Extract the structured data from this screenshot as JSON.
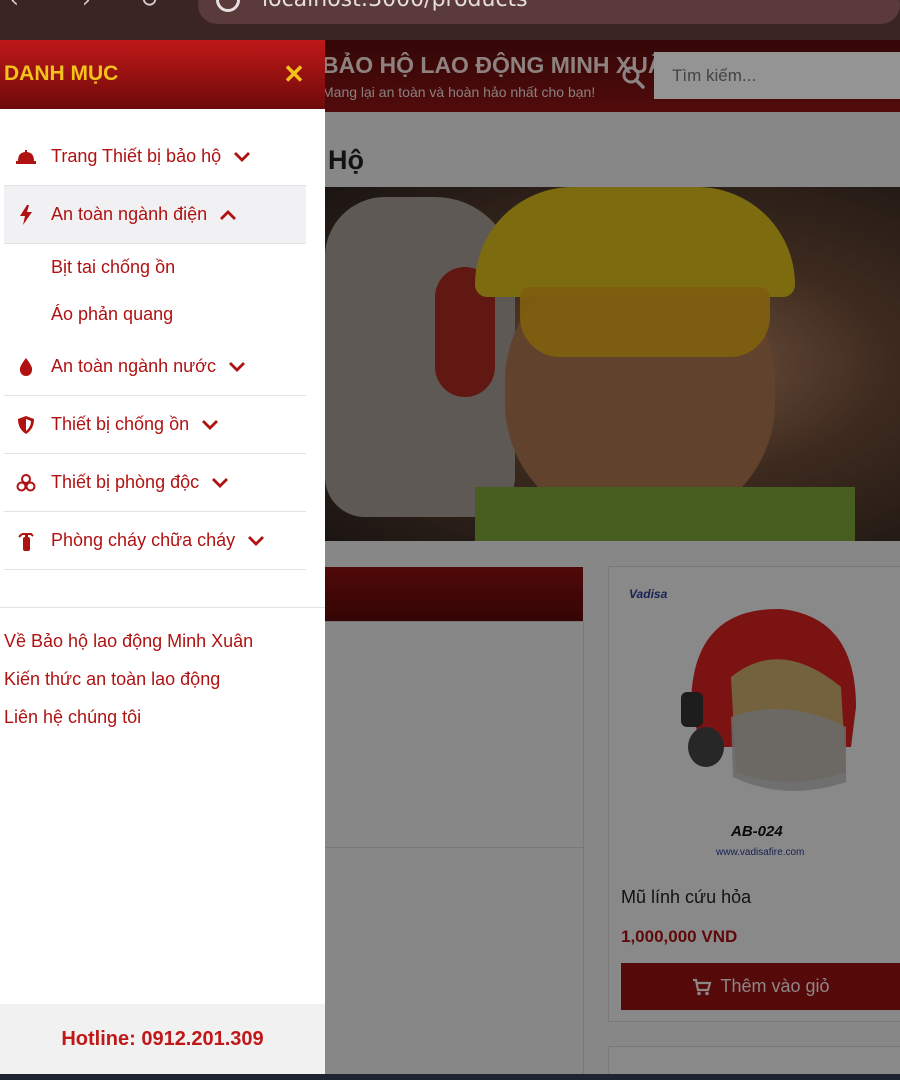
{
  "browser": {
    "url": "localhost:3000/products"
  },
  "header": {
    "title": "BẢO HỘ LAO ĐỘNG MINH XUÂN",
    "slogan": "Mang lại an toàn và hoàn hảo nhất cho bạn!",
    "search_placeholder": "Tìm kiếm..."
  },
  "page": {
    "heading_fragment": "Hộ"
  },
  "product": {
    "brand_logo": "Vadisa",
    "model_code": "AB-024",
    "model_site": "www.vadisafire.com",
    "name": "Mũ lính cứu hỏa",
    "price": "1,000,000 VND",
    "add_to_cart": "Thêm vào giỏ"
  },
  "drawer": {
    "title": "DANH MỤC",
    "close_symbol": "✕",
    "menu": [
      {
        "label": "Trang Thiết bị bảo hộ",
        "icon": "helmet-icon",
        "expanded": false
      },
      {
        "label": "An toàn ngành điện",
        "icon": "bolt-icon",
        "expanded": true,
        "children": [
          "Bịt tai chống ồn",
          "Áo phản quang"
        ]
      },
      {
        "label": "An toàn ngành nước",
        "icon": "water-drop-icon",
        "expanded": false
      },
      {
        "label": "Thiết bị chống ồn",
        "icon": "shield-icon",
        "expanded": false
      },
      {
        "label": "Thiết bị phòng độc",
        "icon": "biohazard-icon",
        "expanded": false
      },
      {
        "label": "Phòng cháy chữa cháy",
        "icon": "fire-extinguisher-icon",
        "expanded": false
      }
    ],
    "footer_links": [
      "Về Bảo hộ lao động Minh Xuân",
      "Kiến thức an toàn lao động",
      "Liên hệ chúng tôi"
    ],
    "hotline": "Hotline: 0912.201.309"
  },
  "colors": {
    "brand_red": "#b01212",
    "accent_yellow": "#f4c21c"
  }
}
